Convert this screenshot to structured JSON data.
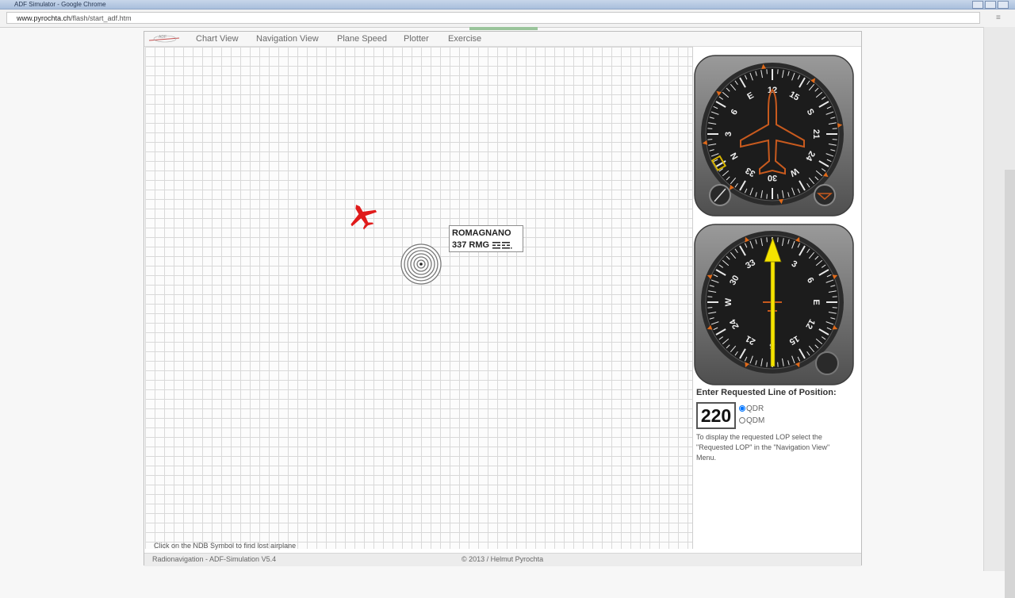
{
  "browser": {
    "title": "ADF Simulator - Google Chrome",
    "url_host": "www.pyrochta.ch",
    "url_path": "/flash/start_adf.htm"
  },
  "menu": {
    "items": [
      "Chart View",
      "Navigation View",
      "Plane Speed",
      "Plotter",
      "Exercise"
    ]
  },
  "station": {
    "name": "ROMAGNANO",
    "ident_line": "337 RMG"
  },
  "hint": "Click on the NDB Symbol to find lost airplane",
  "instrument1": {
    "heading_labels": [
      "N",
      "3",
      "6",
      "E",
      "12",
      "15",
      "S",
      "21",
      "24",
      "W",
      "30",
      "33"
    ],
    "plane_color": "#c85a1e",
    "knob_color": "#555555"
  },
  "instrument2": {
    "heading_labels": [
      "N",
      "3",
      "6",
      "E",
      "12",
      "15",
      "S",
      "21",
      "24",
      "W",
      "30",
      "33"
    ],
    "needle_color": "#f5e400"
  },
  "lop": {
    "label": "Enter Requested Line of Position:",
    "value": "220",
    "options": [
      "QDR",
      "QDM"
    ],
    "selected": "QDR",
    "note": "To display the requested LOP select the \"Requested LOP\" in the \"Navigation View\" Menu."
  },
  "footer": {
    "left": "Radionavigation - ADF-Simulation V5.4",
    "center": "© 2013 / Helmut Pyrochta"
  },
  "colors": {
    "plane_red": "#e01b1b",
    "grid_line": "#d9d9d9",
    "bezel": "#6b6b6b",
    "dial_face": "#1c1c1c"
  }
}
